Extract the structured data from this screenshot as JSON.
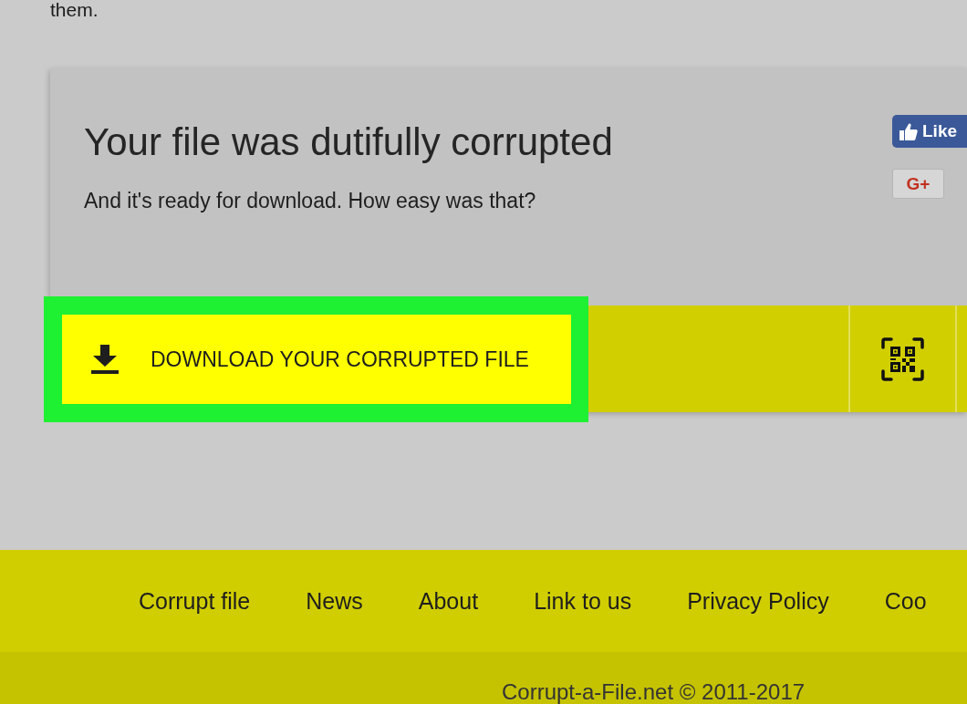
{
  "intro_text": "them.",
  "result_card": {
    "title": "Your file was dutifully corrupted",
    "subtitle": "And it's ready for download. How easy was that?",
    "social_buttons": [
      {
        "kind": "like",
        "label": "Like"
      },
      {
        "kind": "gplus",
        "label": "G+"
      }
    ],
    "download_button": {
      "label": "DOWNLOAD YOUR CORRUPTED FILE",
      "highlighted": true
    }
  },
  "footer": {
    "links": [
      "Corrupt file",
      "News",
      "About",
      "Link to us",
      "Privacy Policy",
      "Coo"
    ],
    "copyright": "Corrupt-a-File.net © 2011-2017"
  }
}
